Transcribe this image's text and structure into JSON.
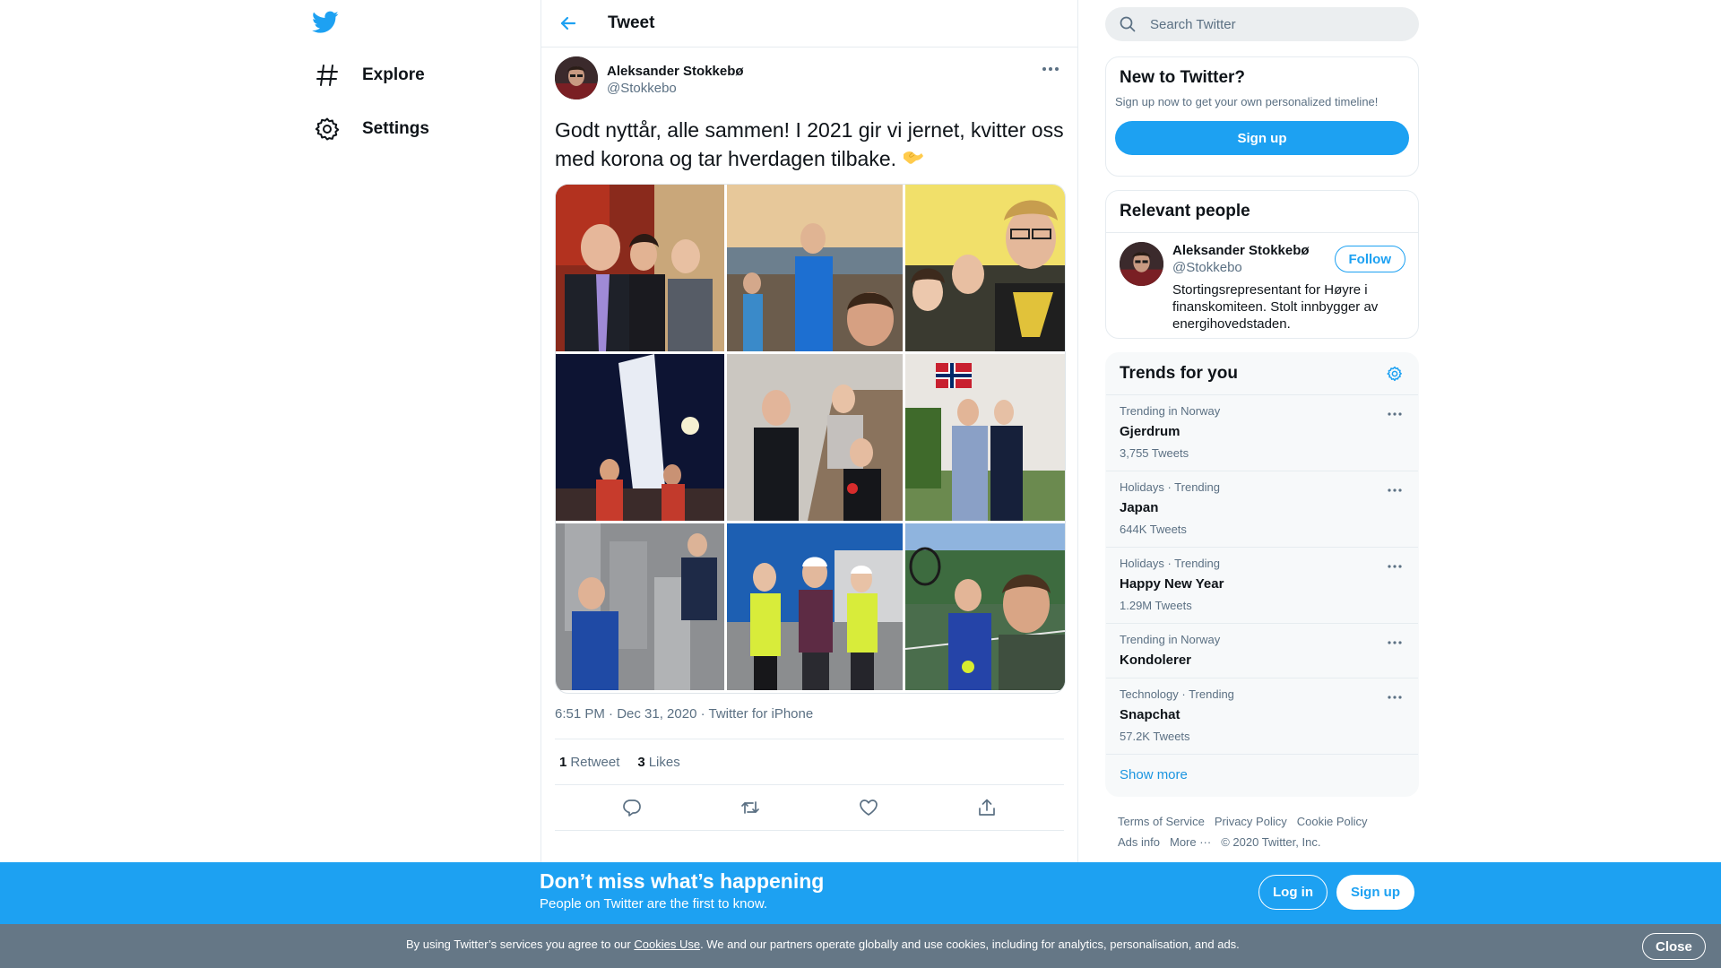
{
  "nav": {
    "items": [
      {
        "label": "Explore"
      },
      {
        "label": "Settings"
      }
    ]
  },
  "header": {
    "title": "Tweet"
  },
  "tweet": {
    "author_name": "Aleksander Stokkebø",
    "author_handle": "@Stokkebo",
    "text": "Godt nyttår, alle sammen! I 2021 gir vi jernet, kvitter oss med korona og tar hverdagen tilbake.",
    "emoji": "🫱",
    "timestamp": "6:51 PM · Dec 31, 2020 · Twitter for iPhone",
    "retweet_count": "1",
    "retweet_label": "Retweet",
    "like_count": "3",
    "like_label": "Likes",
    "photo_count": 9
  },
  "search": {
    "placeholder": "Search Twitter"
  },
  "new_to_twitter": {
    "title": "New to Twitter?",
    "subtitle": "Sign up now to get your own personalized timeline!",
    "signup_label": "Sign up"
  },
  "relevant_people": {
    "title": "Relevant people",
    "name": "Aleksander Stokkebø",
    "handle": "@Stokkebo",
    "bio": "Stortingsrepresentant for Høyre i finanskomiteen. Stolt innbygger av energihovedstaden.",
    "follow_label": "Follow"
  },
  "trends": {
    "title": "Trends for you",
    "items": [
      {
        "meta": "Trending in Norway",
        "name": "Gjerdrum",
        "count": "3,755 Tweets"
      },
      {
        "meta": "Holidays · Trending",
        "name": "Japan",
        "count": "644K Tweets"
      },
      {
        "meta": "Holidays · Trending",
        "name": "Happy New Year",
        "count": "1.29M Tweets"
      },
      {
        "meta": "Trending in Norway",
        "name": "Kondolerer",
        "count": ""
      },
      {
        "meta": "Technology · Trending",
        "name": "Snapchat",
        "count": "57.2K Tweets"
      }
    ],
    "show_more": "Show more"
  },
  "footer": {
    "links": [
      "Terms of Service",
      "Privacy Policy",
      "Cookie Policy",
      "Ads info",
      "More ···"
    ],
    "copyright": "© 2020 Twitter, Inc."
  },
  "banner": {
    "title": "Don’t miss what’s happening",
    "subtitle": "People on Twitter are the first to know.",
    "login_label": "Log in",
    "signup_label": "Sign up"
  },
  "cookie": {
    "prefix": "By using Twitter’s services you agree to our ",
    "link": "Cookies Use",
    "suffix": ". We and our partners operate globally and use cookies, including for analytics, personalisation, and ads.",
    "close_label": "Close"
  },
  "colors": {
    "accent": "#1da1f2",
    "text_primary": "#0f1419",
    "text_secondary": "#5b7083",
    "border": "#e6ecf0",
    "cookie_bar": "#657786"
  }
}
